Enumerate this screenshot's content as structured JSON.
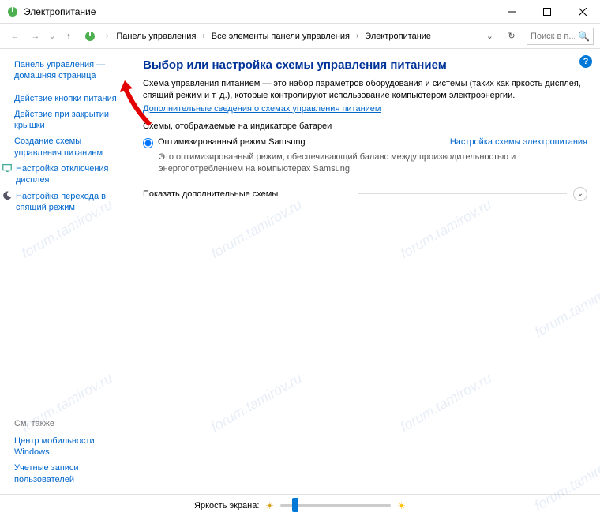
{
  "window": {
    "title": "Электропитание"
  },
  "breadcrumb": {
    "items": [
      "Панель управления",
      "Все элементы панели управления",
      "Электропитание"
    ]
  },
  "search": {
    "placeholder": "Поиск в п..."
  },
  "sidebar": {
    "home": {
      "line1": "Панель управления —",
      "line2": "домашняя страница"
    },
    "links": [
      "Действие кнопки питания",
      "Действие при закрытии крышки",
      "Создание схемы управления питанием",
      "Настройка отключения дисплея",
      "Настройка перехода в спящий режим"
    ],
    "see_also": "См. также",
    "bottom_links": [
      "Центр мобильности Windows",
      "Учетные записи пользователей"
    ]
  },
  "main": {
    "title": "Выбор или настройка схемы управления питанием",
    "description": "Схема управления питанием — это набор параметров оборудования и системы (таких как яркость дисплея, спящий режим и т. д.), которые контролируют использование компьютером электроэнергии.",
    "more_link": "Дополнительные сведения о схемах управления питанием",
    "battery_section": "Схемы, отображаемые на индикаторе батареи",
    "plan": {
      "name": "Оптимизированный режим Samsung",
      "config": "Настройка схемы электропитания",
      "description": "Это оптимизированный режим, обеспечивающий баланс между производительностью и энергопотреблением на компьютерах Samsung."
    },
    "expand": "Показать дополнительные схемы"
  },
  "footer": {
    "brightness": "Яркость экрана:"
  },
  "watermark": "forum.tamirov.ru"
}
